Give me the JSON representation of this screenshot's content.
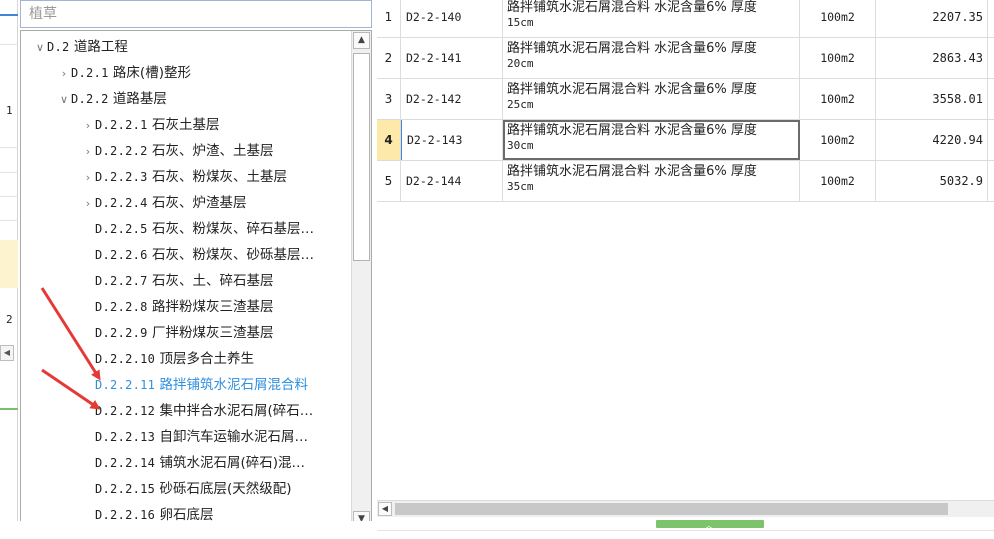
{
  "search": {
    "value": "植草"
  },
  "left_sliver": {
    "numbers": [
      "1",
      "2"
    ]
  },
  "tree": {
    "items": [
      {
        "chevron": "expanded",
        "code": "D.2",
        "label": "道路工程"
      },
      {
        "chevron": "collapsed",
        "code": "D.2.1",
        "label": "路床(槽)整形"
      },
      {
        "chevron": "expanded",
        "code": "D.2.2",
        "label": "道路基层"
      },
      {
        "chevron": "collapsed",
        "code": "D.2.2.1",
        "label": "石灰土基层"
      },
      {
        "chevron": "collapsed",
        "code": "D.2.2.2",
        "label": "石灰、炉渣、土基层"
      },
      {
        "chevron": "collapsed",
        "code": "D.2.2.3",
        "label": "石灰、粉煤灰、土基层"
      },
      {
        "chevron": "collapsed",
        "code": "D.2.2.4",
        "label": "石灰、炉渣基层"
      },
      {
        "chevron": "none",
        "code": "D.2.2.5",
        "label": "石灰、粉煤灰、碎石基层…"
      },
      {
        "chevron": "none",
        "code": "D.2.2.6",
        "label": "石灰、粉煤灰、砂砾基层…"
      },
      {
        "chevron": "none",
        "code": "D.2.2.7",
        "label": "石灰、土、碎石基层"
      },
      {
        "chevron": "none",
        "code": "D.2.2.8",
        "label": "路拌粉煤灰三渣基层"
      },
      {
        "chevron": "none",
        "code": "D.2.2.9",
        "label": "厂拌粉煤灰三渣基层"
      },
      {
        "chevron": "none",
        "code": "D.2.2.10",
        "label": "顶层多合土养生"
      },
      {
        "chevron": "none",
        "code": "D.2.2.11",
        "label": "路拌铺筑水泥石屑混合料",
        "selected": true
      },
      {
        "chevron": "none",
        "code": "D.2.2.12",
        "label": "集中拌合水泥石屑(碎石…"
      },
      {
        "chevron": "none",
        "code": "D.2.2.13",
        "label": "自卸汽车运输水泥石屑…"
      },
      {
        "chevron": "none",
        "code": "D.2.2.14",
        "label": "铺筑水泥石屑(碎石)混…"
      },
      {
        "chevron": "none",
        "code": "D.2.2.15",
        "label": "砂砾石底层(天然级配)"
      },
      {
        "chevron": "none",
        "code": "D.2.2.16",
        "label": "卵石底层"
      }
    ]
  },
  "grid": {
    "rows": [
      {
        "idx": "1",
        "code": "D2-2-140",
        "name": "路拌铺筑水泥石屑混合料 水泥含量6% 厚度",
        "name2": "15cm",
        "unit": "100m2",
        "price": "2207.35"
      },
      {
        "idx": "2",
        "code": "D2-2-141",
        "name": "路拌铺筑水泥石屑混合料 水泥含量6% 厚度",
        "name2": "20cm",
        "unit": "100m2",
        "price": "2863.43"
      },
      {
        "idx": "3",
        "code": "D2-2-142",
        "name": "路拌铺筑水泥石屑混合料 水泥含量6% 厚度",
        "name2": "25cm",
        "unit": "100m2",
        "price": "3558.01"
      },
      {
        "idx": "4",
        "code": "D2-2-143",
        "name": "路拌铺筑水泥石屑混合料 水泥含量6% 厚度",
        "name2": "30cm",
        "unit": "100m2",
        "price": "4220.94",
        "active": true
      },
      {
        "idx": "5",
        "code": "D2-2-144",
        "name": "路拌铺筑水泥石屑混合料 水泥含量6% 厚度",
        "name2": "35cm",
        "unit": "100m2",
        "price": "5032.9"
      }
    ]
  },
  "colors": {
    "selected_text": "#2f8fe0",
    "active_row_index": "#fde9a9",
    "arrow": "#e53935",
    "splitter": "#7cc36b"
  }
}
